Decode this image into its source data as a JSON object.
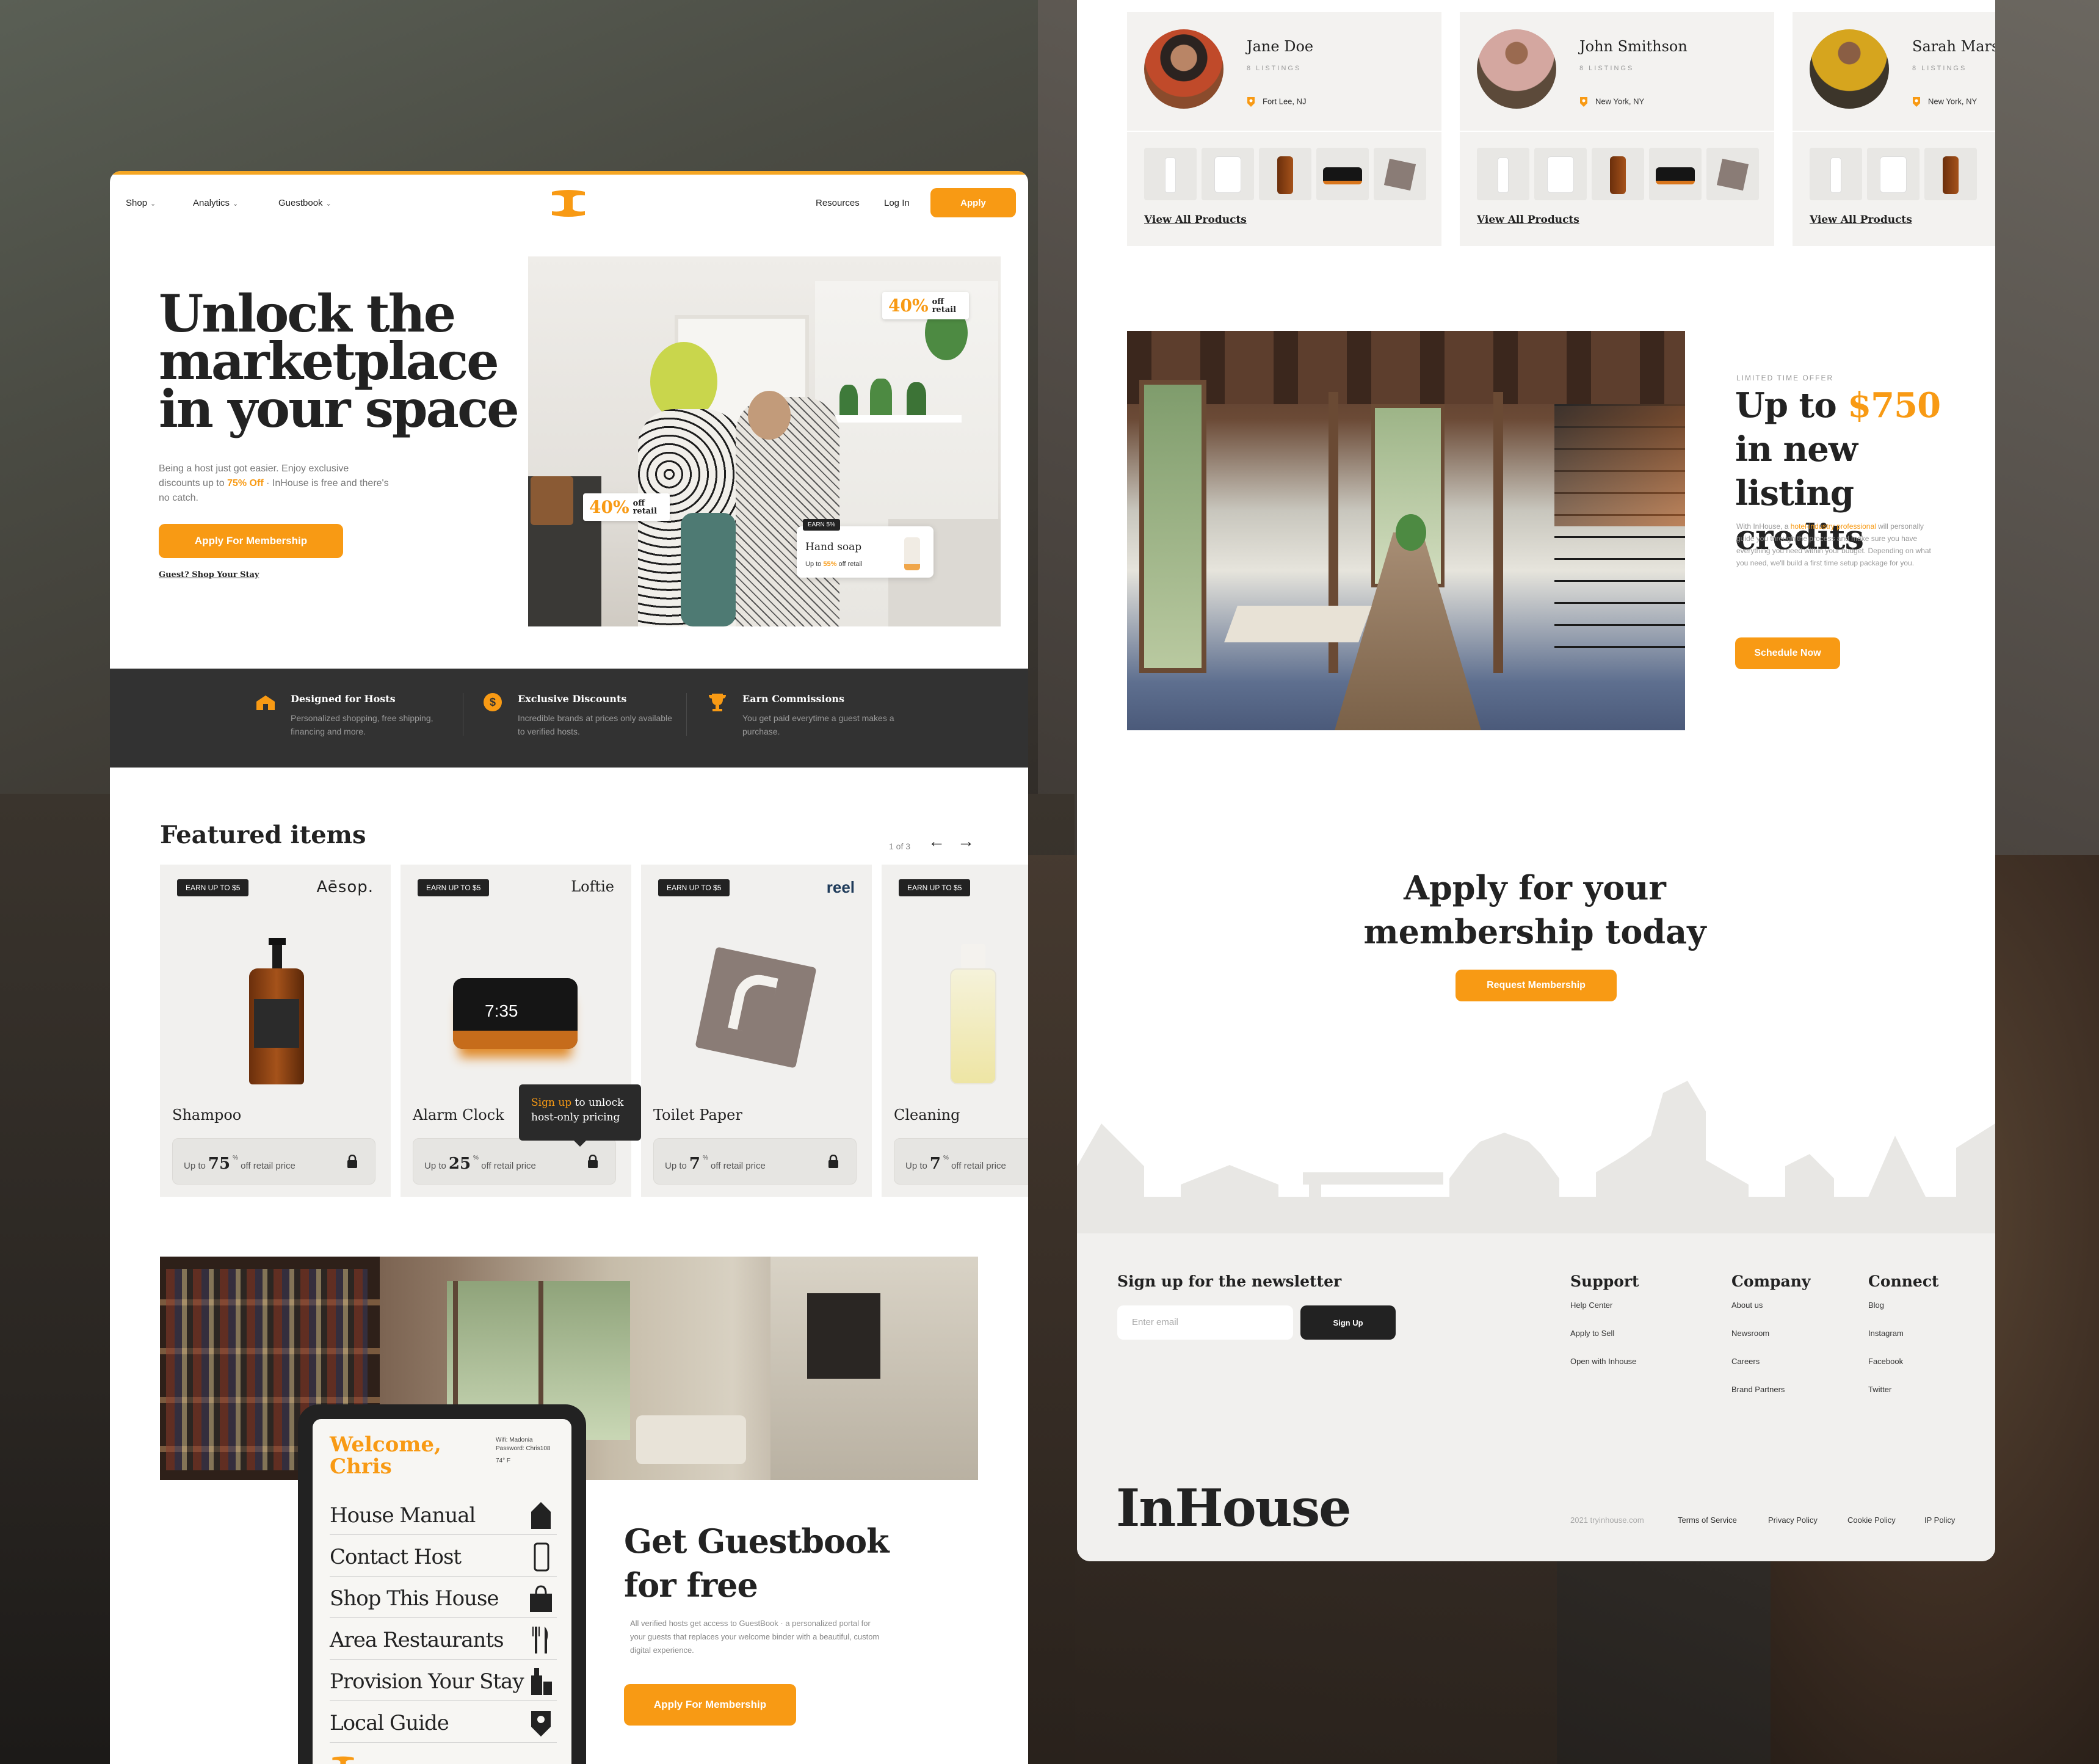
{
  "nav": {
    "links": [
      "Shop",
      "Analytics",
      "Guestbook"
    ],
    "resources": "Resources",
    "login": "Log In",
    "apply": "Apply"
  },
  "hero": {
    "title": "Unlock the marketplace in your space",
    "sub_pre": "Being a host just got easier. Enjoy exclusive discounts up to ",
    "sub_hl": "75% Off",
    "sub_post": " · InHouse is free and there's no catch.",
    "cta": "Apply For Membership",
    "guest_link": "Guest? Shop Your Stay",
    "tag1_pct": "40%",
    "tag1_txt": "off retail",
    "tag2_pct": "40%",
    "tag2_txt": "off retail",
    "popup_earn": "EARN 5%",
    "popup_name": "Hand soap",
    "popup_pre": "Up to ",
    "popup_pct": "55%",
    "popup_post": " off retail"
  },
  "features": [
    {
      "title": "Designed for Hosts",
      "desc": "Personalized shopping, free shipping, financing and more.",
      "icon": "house-icon"
    },
    {
      "title": "Exclusive Discounts",
      "desc": "Incredible brands at prices only available to verified hosts.",
      "icon": "dollar-coin-icon"
    },
    {
      "title": "Earn Commissions",
      "desc": "You get paid everytime a guest makes a purchase.",
      "icon": "trophy-icon"
    }
  ],
  "featured": {
    "title": "Featured items",
    "pager": "1 of 3",
    "items": [
      {
        "earn": "EARN UP TO $5",
        "brand": "Aēsop.",
        "name": "Shampoo",
        "pre": "Up to",
        "pct": "75",
        "post": "off retail price"
      },
      {
        "earn": "EARN UP TO $5",
        "brand": "Loftie",
        "name": "Alarm Clock",
        "pre": "Up to",
        "pct": "25",
        "post": "off retail price"
      },
      {
        "earn": "EARN UP TO $5",
        "brand": "reel",
        "name": "Toilet Paper",
        "pre": "Up to",
        "pct": "7",
        "post": "off retail price"
      },
      {
        "earn": "EARN UP TO $5",
        "brand": "",
        "name": "Cleaning",
        "pre": "Up to",
        "pct": "7",
        "post": "off retail price"
      }
    ],
    "tooltip_hl": "Sign up",
    "tooltip_rest": " to unlock host-only pricing",
    "clock_time": "7:35"
  },
  "guestbook": {
    "welcome": "Welcome, Chris",
    "wifi_line1": "Wifi: Madonia",
    "wifi_line2": "Password: Chris108",
    "temp": "74° F",
    "menu": [
      "House Manual",
      "Contact Host",
      "Shop This House",
      "Area Restaurants",
      "Provision Your Stay",
      "Local Guide"
    ],
    "title": "Get Guestbook for free",
    "desc": "All verified hosts get access to GuestBook · a personalized portal for your guests that replaces your welcome binder with a beautiful, custom digital experience.",
    "cta": "Apply For Membership"
  },
  "hosts": [
    {
      "name": "Jane Doe",
      "listings": "8 LISTINGS",
      "location": "Fort Lee, NJ",
      "link": "View All Products"
    },
    {
      "name": "John Smithson",
      "listings": "8 LISTINGS",
      "location": "New York, NY",
      "link": "View All Products"
    },
    {
      "name": "Sarah Marsh",
      "listings": "8 LISTINGS",
      "location": "New York, NY",
      "link": "View All Products"
    }
  ],
  "offer": {
    "eyebrow": "LIMITED TIME OFFER",
    "title_pre": "Up to ",
    "title_amt": "$750",
    "title_post": " in new listing credits",
    "desc_pre": "With InHouse, a ",
    "desc_hl": "hotel-industry professional",
    "desc_post": " will personally guide you through the process and make sure you have everything you need within your budget. Depending on what you need, we'll build a first time setup package for you.",
    "cta": "Schedule Now"
  },
  "apply": {
    "title": "Apply for your membership today",
    "cta": "Request Membership"
  },
  "footer": {
    "newsletter": "Sign up for the newsletter",
    "email_placeholder": "Enter email",
    "signup": "Sign Up",
    "cols": [
      {
        "title": "Support",
        "links": [
          "Help Center",
          "Apply to Sell",
          "Open with Inhouse"
        ]
      },
      {
        "title": "Company",
        "links": [
          "About us",
          "Newsroom",
          "Careers",
          "Brand Partners"
        ]
      },
      {
        "title": "Connect",
        "links": [
          "Blog",
          "Instagram",
          "Facebook",
          "Twitter"
        ]
      }
    ],
    "brand": "InHouse",
    "copyright": "2021 tryinhouse.com",
    "legal": [
      "Terms of Service",
      "Privacy Policy",
      "Cookie Policy",
      "IP Policy"
    ]
  },
  "colors": {
    "accent": "#f89a14",
    "dark": "#323232",
    "card": "#f1f0ee"
  }
}
